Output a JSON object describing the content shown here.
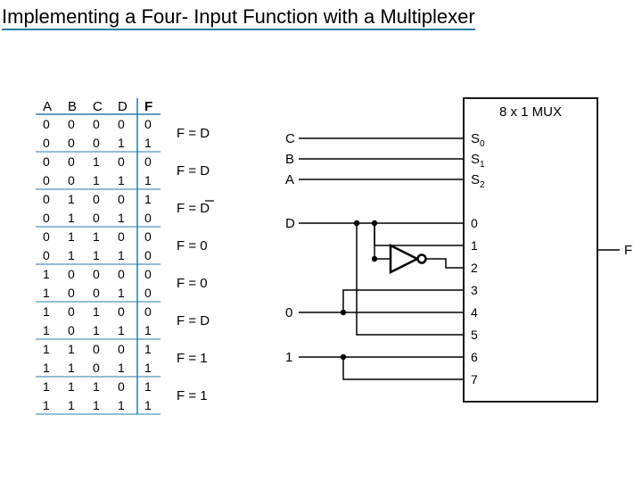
{
  "title": "Implementing a Four- Input Function with a Multiplexer",
  "truth_table": {
    "headers": [
      "A",
      "B",
      "C",
      "D",
      "F"
    ],
    "rows": [
      [
        "0",
        "0",
        "0",
        "0",
        "0"
      ],
      [
        "0",
        "0",
        "0",
        "1",
        "1"
      ],
      [
        "0",
        "0",
        "1",
        "0",
        "0"
      ],
      [
        "0",
        "0",
        "1",
        "1",
        "1"
      ],
      [
        "0",
        "1",
        "0",
        "0",
        "1"
      ],
      [
        "0",
        "1",
        "0",
        "1",
        "0"
      ],
      [
        "0",
        "1",
        "1",
        "0",
        "0"
      ],
      [
        "0",
        "1",
        "1",
        "1",
        "0"
      ],
      [
        "1",
        "0",
        "0",
        "0",
        "0"
      ],
      [
        "1",
        "0",
        "0",
        "1",
        "0"
      ],
      [
        "1",
        "0",
        "1",
        "0",
        "0"
      ],
      [
        "1",
        "0",
        "1",
        "1",
        "1"
      ],
      [
        "1",
        "1",
        "0",
        "0",
        "1"
      ],
      [
        "1",
        "1",
        "0",
        "1",
        "1"
      ],
      [
        "1",
        "1",
        "1",
        "0",
        "1"
      ],
      [
        "1",
        "1",
        "1",
        "1",
        "1"
      ]
    ],
    "group_labels": [
      "F = D",
      "F = D",
      "F = D̄",
      "F = 0",
      "F = 0",
      "F = D",
      "F = 1",
      "F = 1"
    ],
    "group_label_plain_2": "F = D"
  },
  "mux": {
    "label": "8 x 1 MUX",
    "select_labels": [
      "S",
      "S",
      "S"
    ],
    "select_sub": [
      "0",
      "1",
      "2"
    ],
    "data_labels": [
      "0",
      "1",
      "2",
      "3",
      "4",
      "5",
      "6",
      "7"
    ],
    "output_label": "F"
  },
  "inputs": {
    "select_signals": [
      "C",
      "B",
      "A"
    ],
    "d_label": "D",
    "zero_label": "0",
    "one_label": "1"
  }
}
